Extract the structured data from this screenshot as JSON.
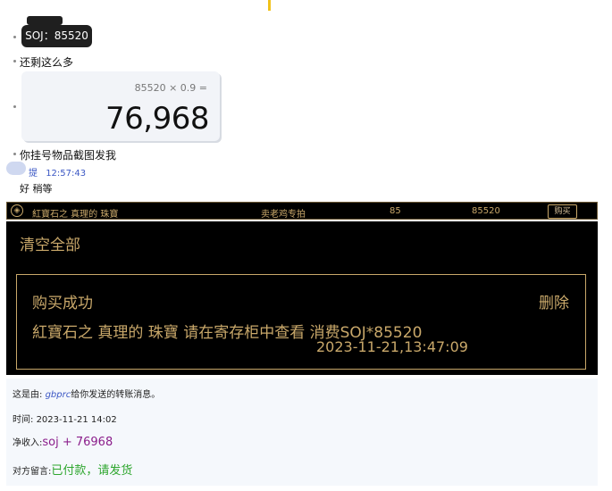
{
  "chat": {
    "soj_bubble": "SOJ：85520",
    "msg_remaining": "还剩这么多",
    "calc_expression": "85520 × 0.9 =",
    "calc_result": "76,968",
    "msg_screenshot": "你挂号物品截图发我",
    "sender_name": "提",
    "sender_time": "12:57:43",
    "msg_ok": "好 稍等"
  },
  "listing_bar": {
    "item_name": "紅寶石之 真理的 珠寶",
    "seller": "卖老鸡专拍",
    "level": "85",
    "price": "85520",
    "buy_label": "购买"
  },
  "game_panel": {
    "clear_all": "清空全部",
    "success_title": "购买成功",
    "delete_label": "删除",
    "success_text": "紅寶石之 真理的 珠寶 请在寄存柜中查看 消费SOJ*85520",
    "success_time": "2023-11-21,13:47:09"
  },
  "notification": {
    "from_prefix": "这是由:",
    "from_user": "gbprc",
    "from_suffix": "给你发送的转账消息。",
    "time_label": "时间:",
    "time_value": "2023-11-21 14:02",
    "income_label": "净收入:",
    "income_value": "soj + 76968",
    "remark_label": "对方留言:",
    "remark_value": "已付款，请发货"
  },
  "colors": {
    "gold": "#c9a86a",
    "link_blue": "#3b57c4",
    "income_purple": "#8b1e8b",
    "remark_green": "#2ea62e"
  }
}
